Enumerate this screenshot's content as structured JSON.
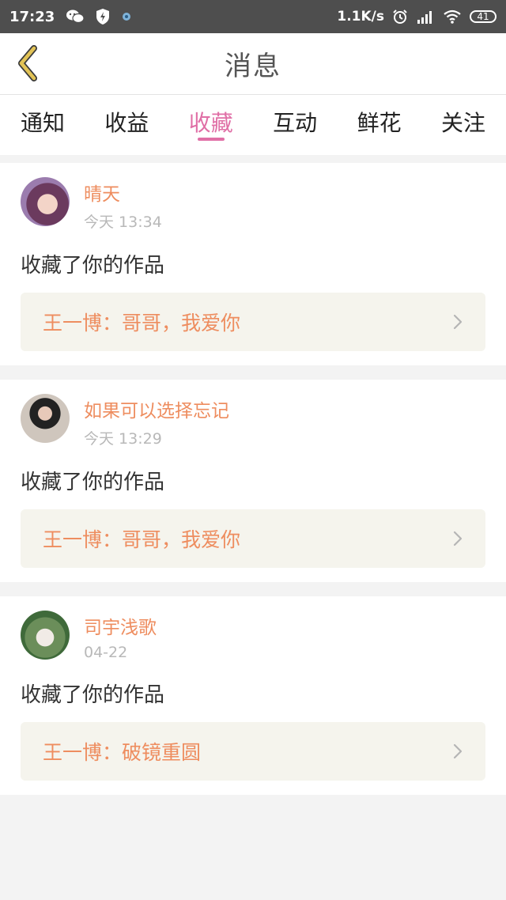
{
  "status_bar": {
    "time": "17:23",
    "net_speed": "1.1K/s",
    "battery": "41",
    "icons": [
      "wechat-icon",
      "shield-bolt-icon",
      "app-notify-icon",
      "alarm-icon",
      "signal-icon",
      "wifi-icon",
      "battery-icon"
    ]
  },
  "header": {
    "title": "消息",
    "back_icon": "chevron-left-icon",
    "accent": "#c8a43c"
  },
  "tabs": {
    "items": [
      {
        "label": "通知"
      },
      {
        "label": "收益"
      },
      {
        "label": "收藏",
        "active": true
      },
      {
        "label": "互动"
      },
      {
        "label": "鲜花"
      },
      {
        "label": "关注"
      }
    ],
    "active_color": "#e06fa6"
  },
  "messages": [
    {
      "name": "晴天",
      "time": "今天 13:34",
      "action": "收藏了你的作品",
      "quote": "王一博：哥哥，我爱你"
    },
    {
      "name": "如果可以选择忘记",
      "time": "今天 13:29",
      "action": "收藏了你的作品",
      "quote": "王一博：哥哥，我爱你"
    },
    {
      "name": "司宇浅歌",
      "time": "04-22",
      "action": "收藏了你的作品",
      "quote": "王一博：破镜重圆"
    }
  ],
  "colors": {
    "name": "#ee8d5f",
    "quote_bg": "#f5f4ed"
  }
}
